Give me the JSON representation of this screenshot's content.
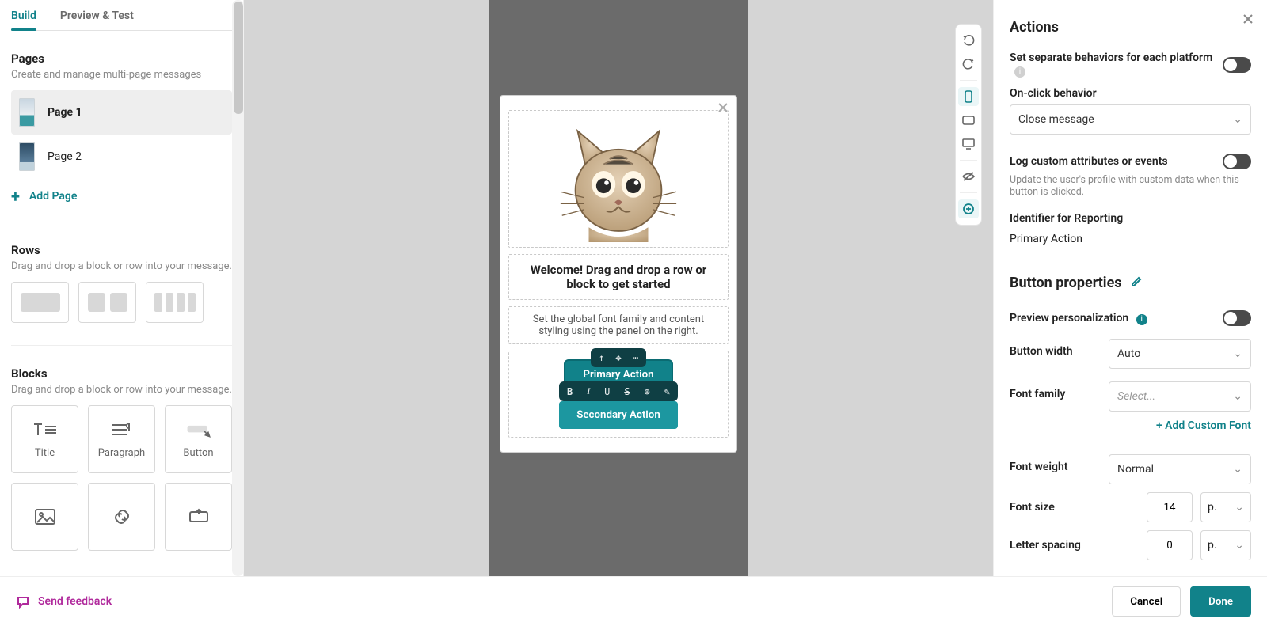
{
  "tabs": {
    "build": "Build",
    "preview": "Preview & Test"
  },
  "pages": {
    "title": "Pages",
    "hint": "Create and manage multi-page messages",
    "items": [
      {
        "label": "Page 1"
      },
      {
        "label": "Page 2"
      }
    ],
    "add": "Add Page"
  },
  "rows": {
    "title": "Rows",
    "hint": "Drag and drop a block or row into your message."
  },
  "blocks": {
    "title": "Blocks",
    "hint": "Drag and drop a block or row into your message.",
    "items": {
      "title": "Title",
      "paragraph": "Paragraph",
      "button": "Button"
    }
  },
  "message": {
    "headline": "Welcome! Drag and drop a row or block to get started",
    "paragraph": "Set the global font family and content styling using the panel on the right.",
    "primary_btn": "Primary Action",
    "secondary_btn": "Secondary Action"
  },
  "inspector": {
    "actions_title": "Actions",
    "separate_label": "Set separate behaviors for each platform",
    "onclick_label": "On-click behavior",
    "onclick_value": "Close message",
    "log_label": "Log custom attributes or events",
    "log_hint": "Update the user's profile with custom data when this button is clicked.",
    "identifier_label": "Identifier for Reporting",
    "identifier_value": "Primary Action",
    "props_title": "Button properties",
    "preview_pers": "Preview personalization",
    "width_label": "Button width",
    "width_value": "Auto",
    "font_family_label": "Font family",
    "font_family_value": "Select...",
    "add_font": "+ Add Custom Font",
    "font_weight_label": "Font weight",
    "font_weight_value": "Normal",
    "font_size_label": "Font size",
    "font_size_value": "14",
    "unit": "p.",
    "letter_label": "Letter spacing",
    "letter_value": "0"
  },
  "footer": {
    "feedback": "Send feedback",
    "cancel": "Cancel",
    "done": "Done"
  }
}
